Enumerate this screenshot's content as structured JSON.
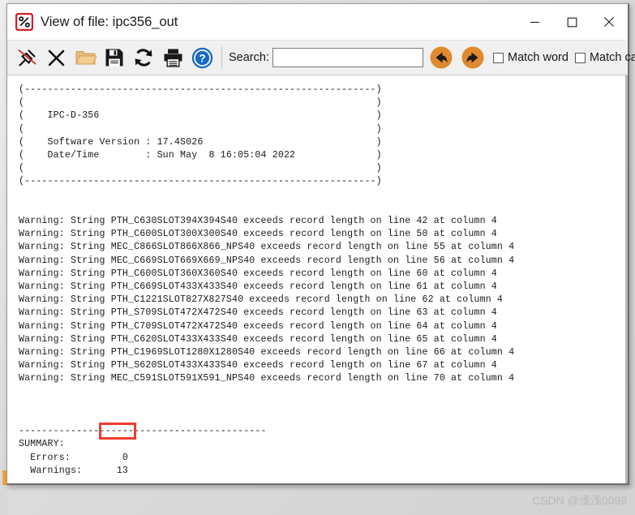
{
  "window": {
    "title": "View of file: ipc356_out",
    "app_icon": "pcb-via-icon",
    "minimize_label": "—",
    "maximize_label": "□",
    "close_label": "✕"
  },
  "toolbar": {
    "buttons": [
      {
        "name": "pin-icon",
        "label": "Pin"
      },
      {
        "name": "close-file-icon",
        "label": "Close"
      },
      {
        "name": "open-folder-icon",
        "label": "Open"
      },
      {
        "name": "save-icon",
        "label": "Save"
      },
      {
        "name": "refresh-icon",
        "label": "Refresh"
      },
      {
        "name": "print-icon",
        "label": "Print"
      },
      {
        "name": "help-icon",
        "label": "Help"
      }
    ],
    "search_label": "Search:",
    "search_value": "",
    "search_placeholder": "",
    "prev_button_label": "Find previous",
    "next_button_label": "Find next",
    "match_word_label": "Match word",
    "match_word_checked": false,
    "match_case_label": "Match case",
    "match_case_checked": false
  },
  "document": {
    "header_lines": [
      "(-------------------------------------------------------------)",
      "(                                                             )",
      "(    IPC-D-356                                                )",
      "(                                                             )",
      "(    Software Version : 17.4S026                              )",
      "(    Date/Time        : Sun May  8 16:05:04 2022              )",
      "(                                                             )",
      "(-------------------------------------------------------------)"
    ],
    "warnings": [
      "Warning: String PTH_C630SLOT394X394S40 exceeds record length on line 42 at column 4",
      "Warning: String PTH_C600SLOT300X300S40 exceeds record length on line 50 at column 4",
      "Warning: String MEC_C866SLOT866X866_NPS40 exceeds record length on line 55 at column 4",
      "Warning: String MEC_C669SLOT669X669_NPS40 exceeds record length on line 56 at column 4",
      "Warning: String PTH_C600SLOT360X360S40 exceeds record length on line 60 at column 4",
      "Warning: String PTH_C669SLOT433X433S40 exceeds record length on line 61 at column 4",
      "Warning: String PTH_C1221SLOT827X827S40 exceeds record length on line 62 at column 4",
      "Warning: String PTH_S709SLOT472X472S40 exceeds record length on line 63 at column 4",
      "Warning: String PTH_C709SLOT472X472S40 exceeds record length on line 64 at column 4",
      "Warning: String PTH_C620SLOT433X433S40 exceeds record length on line 65 at column 4",
      "Warning: String PTH_C1969SLOT1280X1280S40 exceeds record length on line 66 at column 4",
      "Warning: String PTH_S620SLOT433X433S40 exceeds record length on line 67 at column 4",
      "Warning: String MEC_C591SLOT591X591_NPS40 exceeds record length on line 70 at column 4"
    ],
    "summary_divider": "-------------------------------------------",
    "summary_title": "SUMMARY:",
    "summary_rows": [
      {
        "label": "  Errors:",
        "value": "0"
      },
      {
        "label": "  Warnings:",
        "value": "13"
      }
    ],
    "body_text": "(-------------------------------------------------------------)\n(                                                             )\n(    IPC-D-356                                                )\n(                                                             )\n(    Software Version : 17.4S026                              )\n(    Date/Time        : Sun May  8 16:05:04 2022              )\n(                                                             )\n(-------------------------------------------------------------)\n\n\nWarning: String PTH_C630SLOT394X394S40 exceeds record length on line 42 at column 4\nWarning: String PTH_C600SLOT300X300S40 exceeds record length on line 50 at column 4\nWarning: String MEC_C866SLOT866X866_NPS40 exceeds record length on line 55 at column 4\nWarning: String MEC_C669SLOT669X669_NPS40 exceeds record length on line 56 at column 4\nWarning: String PTH_C600SLOT360X360S40 exceeds record length on line 60 at column 4\nWarning: String PTH_C669SLOT433X433S40 exceeds record length on line 61 at column 4\nWarning: String PTH_C1221SLOT827X827S40 exceeds record length on line 62 at column 4\nWarning: String PTH_S709SLOT472X472S40 exceeds record length on line 63 at column 4\nWarning: String PTH_C709SLOT472X472S40 exceeds record length on line 64 at column 4\nWarning: String PTH_C620SLOT433X433S40 exceeds record length on line 65 at column 4\nWarning: String PTH_C1969SLOT1280X1280S40 exceeds record length on line 66 at column 4\nWarning: String PTH_S620SLOT433X433S40 exceeds record length on line 67 at column 4\nWarning: String MEC_C591SLOT591X591_NPS40 exceeds record length on line 70 at column 4\n\n\n\n-------------------------------------------\nSUMMARY:\n  Errors:         0\n  Warnings:      13"
  },
  "annotation": {
    "name": "errors-value-highlight",
    "color": "#f23a30",
    "target_value": "0"
  },
  "watermark": {
    "text": "CSDN @浅浅0099"
  }
}
